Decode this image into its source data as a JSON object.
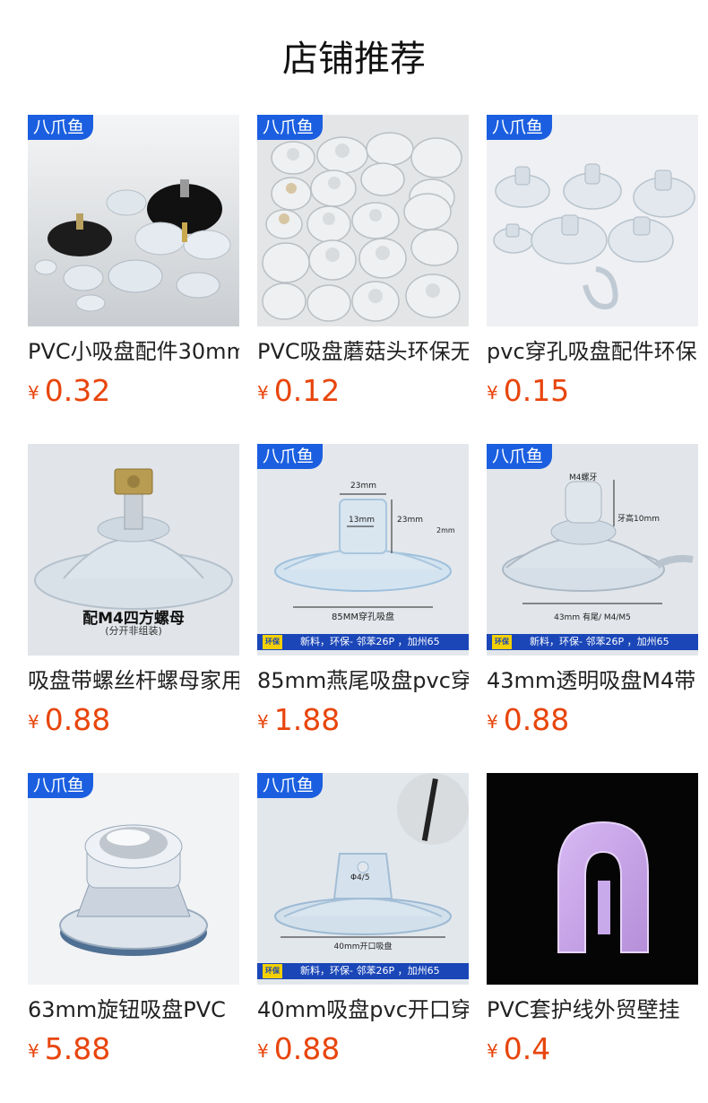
{
  "header": {
    "title": "店铺推荐"
  },
  "currency": "¥",
  "products": [
    {
      "badge": "八爪鱼",
      "name": "PVC小吸盘配件30mm",
      "price": "0.32",
      "image": "suction-cups-assorted-bolts"
    },
    {
      "badge": "八爪鱼",
      "name": "PVC吸盘蘑菇头环保无",
      "price": "0.12",
      "image": "mushroom-suction-cups-grid"
    },
    {
      "badge": "八爪鱼",
      "name": "pvc穿孔吸盘配件环保",
      "price": "0.15",
      "image": "clear-suction-cups-hook"
    },
    {
      "badge": "",
      "name": "吸盘带螺丝杆螺母家用",
      "price": "0.88",
      "image": "suction-cup-square-nut",
      "overlay_text": [
        "配M4四方螺母",
        "(分开非组装)"
      ]
    },
    {
      "badge": "八爪鱼",
      "name": "85mm燕尾吸盘pvc穿",
      "price": "1.88",
      "image": "85mm-dovetail-suction-cup",
      "overlay_text": [
        "23mm",
        "13mm",
        "23mm",
        "2mm",
        "85MM穿孔吸盘",
        "新料，环保- 邻苯26P ，加州65"
      ],
      "strip_tag": "环保"
    },
    {
      "badge": "八爪鱼",
      "name": "43mm透明吸盘M4带",
      "price": "0.88",
      "image": "43mm-clear-suction-cup-m4",
      "overlay_text": [
        "M4螺牙",
        "牙高10mm",
        "43mm 有尾/ M4/M5",
        "新料，环保- 邻苯26P ，加州65"
      ],
      "strip_tag": "环保"
    },
    {
      "badge": "八爪鱼",
      "name": "63mm旋钮吸盘PVC",
      "price": "5.88",
      "image": "63mm-knob-suction-cup"
    },
    {
      "badge": "八爪鱼",
      "name": "40mm吸盘pvc开口穿",
      "price": "0.88",
      "image": "40mm-open-suction-cup",
      "overlay_text": [
        "Φ4/5",
        "40mm开口吸盘",
        "新料，环保- 邻苯26P ，加州65"
      ],
      "strip_tag": "环保"
    },
    {
      "badge": "",
      "name": "PVC套护线外贸壁挂",
      "price": "0.4",
      "image": "purple-cable-clip"
    }
  ]
}
